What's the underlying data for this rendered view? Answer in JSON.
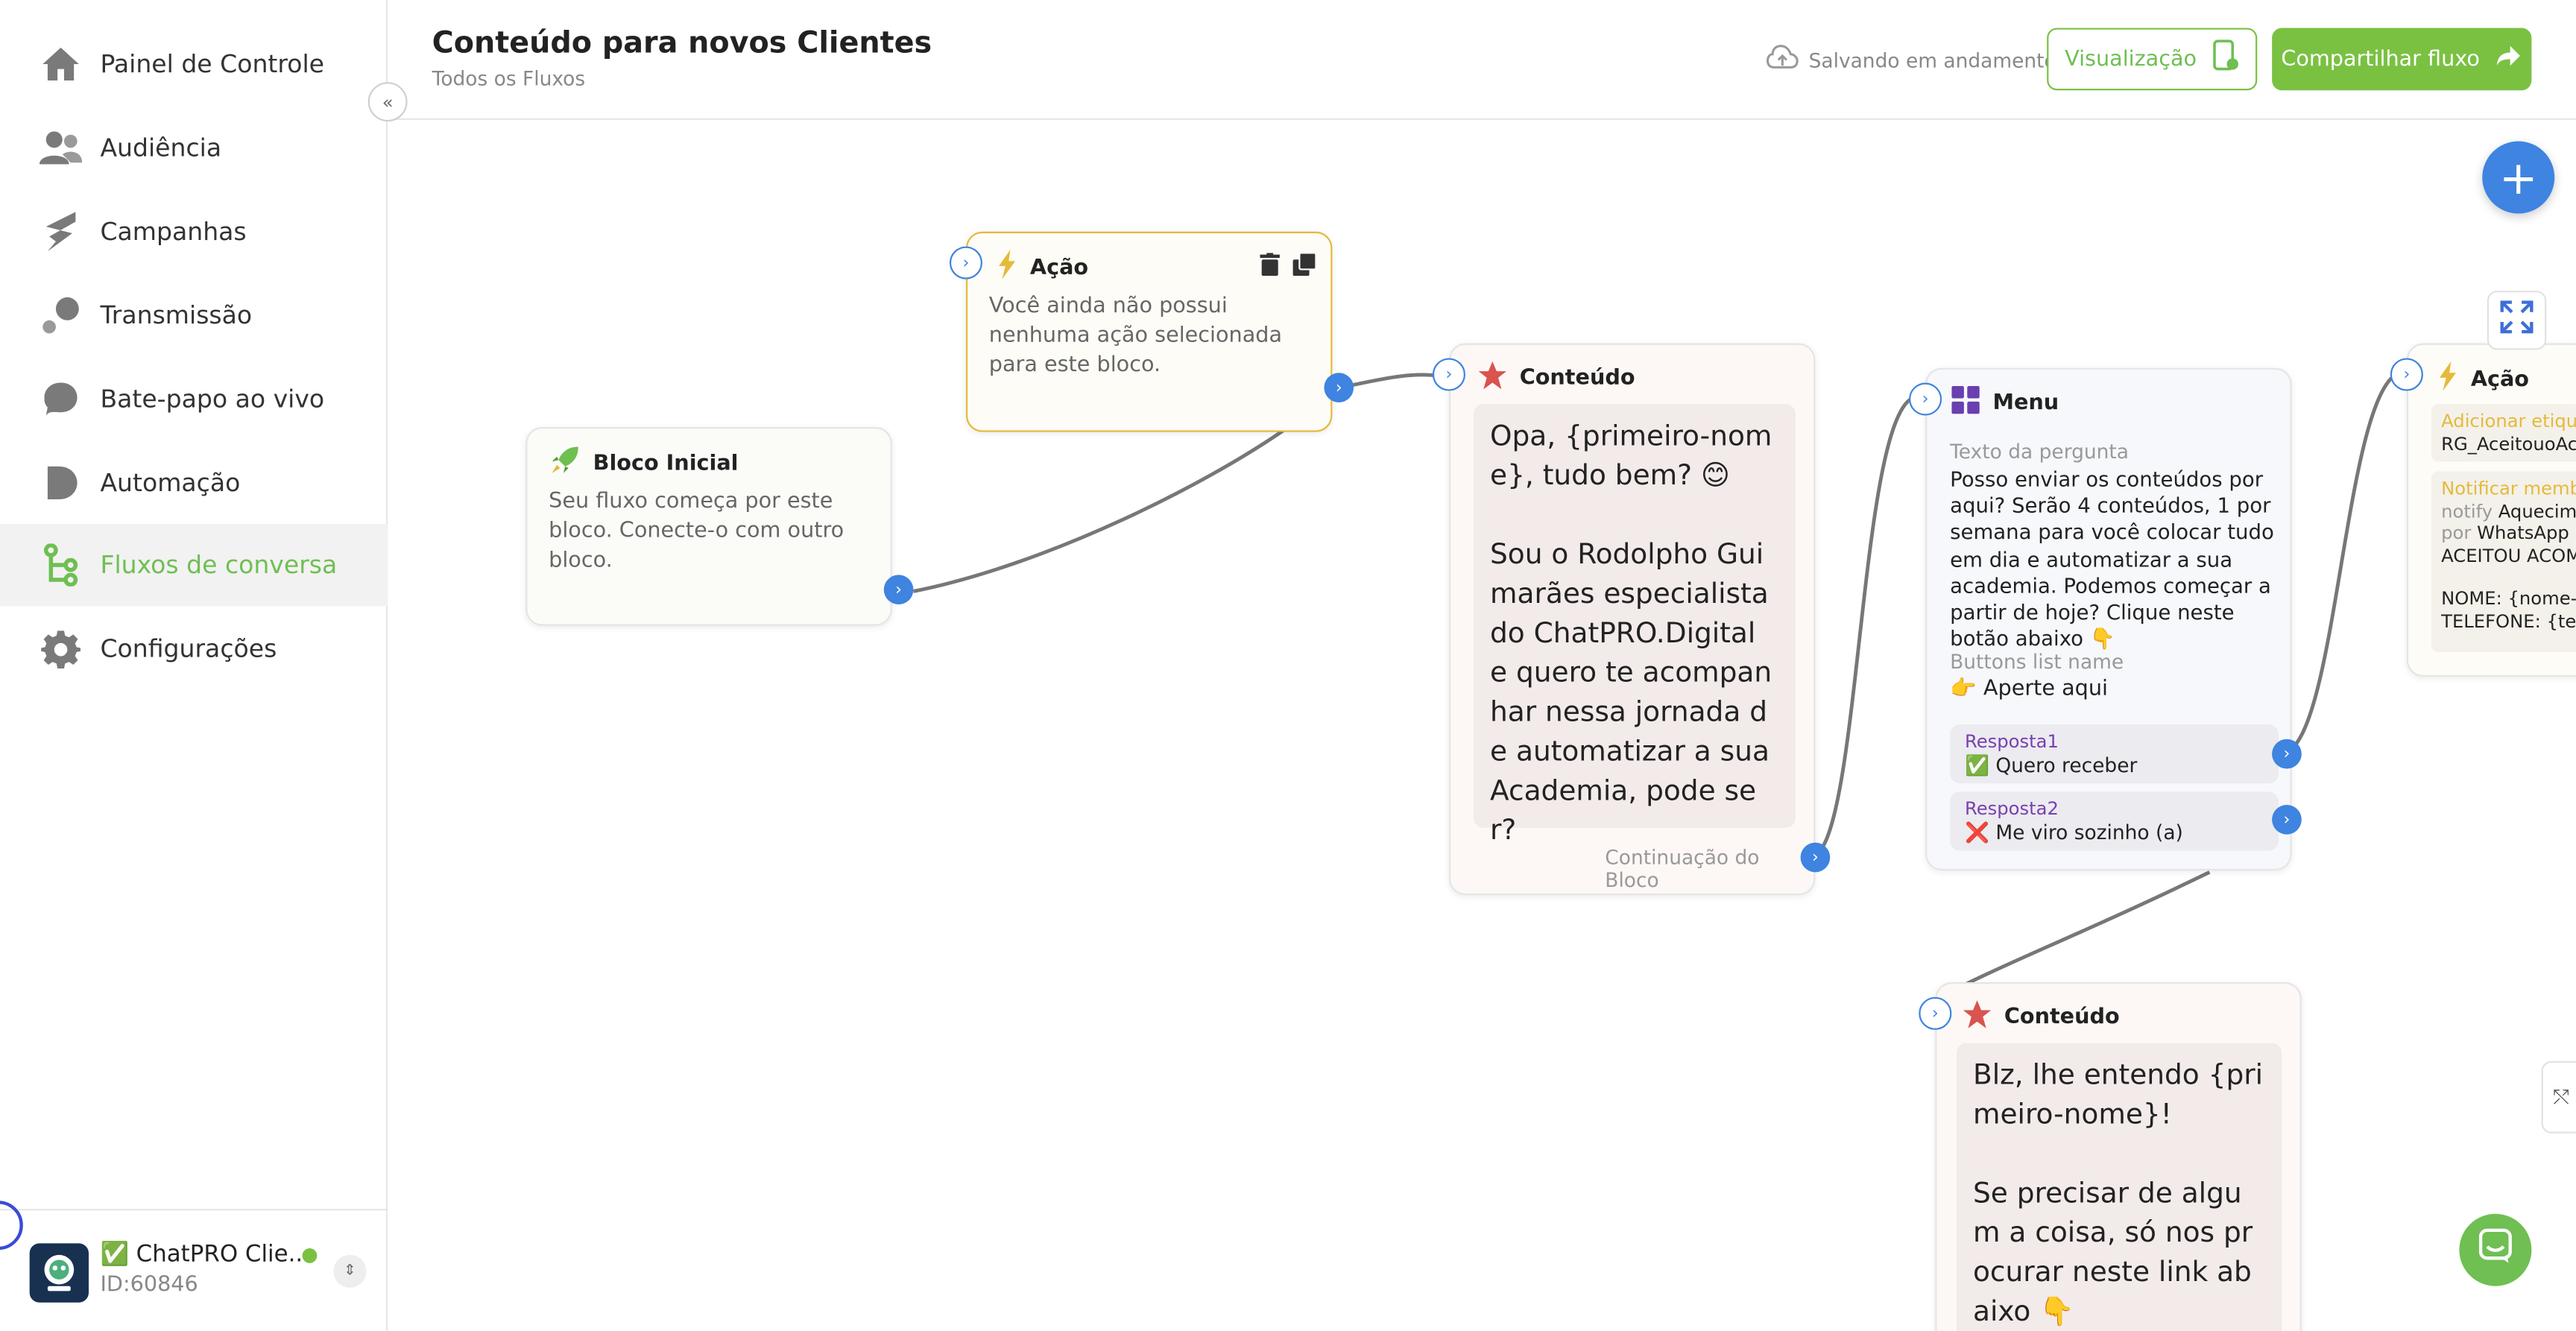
{
  "sidebar": {
    "items": [
      {
        "label": "Painel de Controle",
        "icon": "home-icon"
      },
      {
        "label": "Audiência",
        "icon": "users-icon"
      },
      {
        "label": "Campanhas",
        "icon": "campaign-icon"
      },
      {
        "label": "Transmissão",
        "icon": "broadcast-icon"
      },
      {
        "label": "Bate-papo ao vivo",
        "icon": "chat-bubble-icon"
      },
      {
        "label": "Automação",
        "icon": "automation-icon"
      },
      {
        "label": "Fluxos de conversa",
        "icon": "flow-icon"
      },
      {
        "label": "Configurações",
        "icon": "gear-icon"
      }
    ],
    "active_index": 6,
    "account": {
      "name": "✅ ChatPRO Clie...",
      "id": "ID:60846",
      "status_color": "#7ac142"
    }
  },
  "header": {
    "title": "Conteúdo para novos Clientes",
    "breadcrumb": "Todos os Fluxos",
    "save_status": "Salvando em andamento",
    "preview_label": "Visualização",
    "share_label": "Compartilhar fluxo"
  },
  "colors": {
    "accent": "#7ac142",
    "port": "#3e84e0",
    "action_border": "#e6b93a"
  },
  "nodes": {
    "start": {
      "title": "Bloco Inicial",
      "text": "Seu fluxo começa por este bloco. Conecte-o com outro bloco."
    },
    "action1": {
      "title": "Ação",
      "text": "Você ainda não possui nenhuma ação selecionada para este bloco."
    },
    "content1": {
      "title": "Conteúdo",
      "message": "Opa, {primeiro-nome}, tudo bem? 😊\n\nSou o Rodolpho Guimarães especialista do ChatPRO.Digital e quero te acompanhar nessa jornada de automatizar a sua Academia, pode ser?",
      "continuation": "Continuação do Bloco"
    },
    "menu": {
      "title": "Menu",
      "question_label": "Texto da pergunta",
      "question": "Posso enviar os conteúdos por aqui? Serão 4 conteúdos, 1 por semana para você colocar tudo em dia e automatizar a sua academia. Podemos começar a partir de hoje? Clique neste botão abaixo 👇",
      "list_label": "Buttons list name",
      "list_name": "👉 Aperte aqui",
      "responses": [
        {
          "label": "Resposta1",
          "text": "✅ Quero receber"
        },
        {
          "label": "Resposta2",
          "text": "❌ Me viro sozinho (a)"
        }
      ]
    },
    "action2": {
      "title": "Ação",
      "tag_label": "Adicionar etiqueta",
      "tag_value": "RG_AceitouoAc",
      "notify_label": "Notificar membro",
      "notify_line1_prefix": "notify",
      "notify_line1_value": "Aquecime",
      "notify_line2_prefix": "por",
      "notify_line2_value": "WhatsApp",
      "notify_line3": "ACEITOU ACOM",
      "notify_line4": "NOME: {nome-c",
      "notify_line5": "TELEFONE: {tele"
    },
    "content2": {
      "title": "Conteúdo",
      "message": "Blz, lhe entendo {primeiro-nome}!\n\nSe precisar de algum a coisa, só nos procurar neste link abaixo 👇"
    }
  }
}
